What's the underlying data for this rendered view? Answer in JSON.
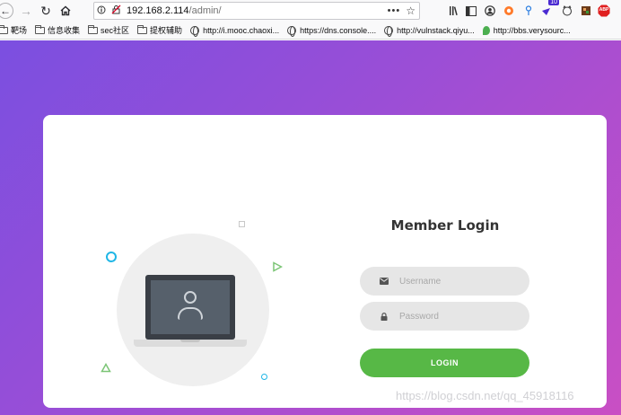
{
  "browser": {
    "url_host": "192.168.2.114",
    "url_path": "/admin/",
    "page_actions_glyph": "•••",
    "badge_count": "10",
    "abp_label": "ABP"
  },
  "bookmarks": [
    {
      "label": "靶场",
      "icon": "folder-icon"
    },
    {
      "label": "信息收集",
      "icon": "folder-icon"
    },
    {
      "label": "sec社区",
      "icon": "folder-icon"
    },
    {
      "label": "提权辅助",
      "icon": "folder-icon"
    },
    {
      "label": "http://i.mooc.chaoxi...",
      "icon": "globe-icon"
    },
    {
      "label": "https://dns.console....",
      "icon": "globe-icon"
    },
    {
      "label": "http://vulnstack.qiyu...",
      "icon": "globe-icon"
    },
    {
      "label": "http://bbs.verysourc...",
      "icon": "leaf-icon"
    }
  ],
  "login": {
    "title": "Member Login",
    "username_placeholder": "Username",
    "password_placeholder": "Password",
    "button_label": "LOGIN"
  },
  "watermark": "https://blog.csdn.net/qq_45918116",
  "colors": {
    "gradient_start": "#7b4fe0",
    "gradient_end": "#c94fc4",
    "login_button": "#57b846",
    "field_bg": "#e6e6e6"
  }
}
